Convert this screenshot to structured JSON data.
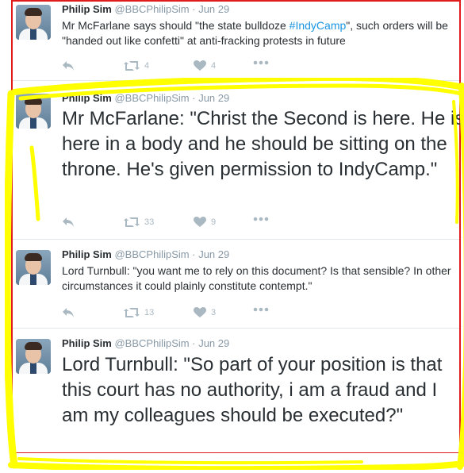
{
  "tweets": [
    {
      "name": "Philip Sim",
      "handle": "@BBCPhilipSim",
      "separator": "·",
      "time": "Jun 29",
      "text_before": "Mr McFarlane says should \"the state bulldoze ",
      "hashtag": "#IndyCamp",
      "text_after": "\", such orders will be \"handed out like confetti\" at anti-fracking protests in future",
      "retweets": "4",
      "likes": "4"
    },
    {
      "name": "Philip Sim",
      "handle": "@BBCPhilipSim",
      "separator": "·",
      "time": "Jun 29",
      "text": "Mr McFarlane: \"Christ the Second is here. He is here in a body and he should be sitting on the throne. He's given permission to IndyCamp.\"",
      "retweets": "33",
      "likes": "9"
    },
    {
      "name": "Philip Sim",
      "handle": "@BBCPhilipSim",
      "separator": "·",
      "time": "Jun 29",
      "text": "Lord Turnbull: \"you want me to rely on this document? Is that sensible? In other circumstances it could plainly constitute contempt.\"",
      "retweets": "13",
      "likes": "3"
    },
    {
      "name": "Philip Sim",
      "handle": "@BBCPhilipSim",
      "separator": "·",
      "time": "Jun 29",
      "text": "Lord Turnbull: \"So part of your position is that this court has no authority, i am a fraud and I am my colleagues should be executed?\""
    }
  ],
  "icons": {
    "reply": "reply-arrow-icon",
    "retweet": "retweet-icon",
    "like": "heart-icon",
    "more": "more-dots-icon"
  },
  "colors": {
    "frame": "#e01b1b",
    "highlight": "#ffff00",
    "hashtag": "#1b95e0",
    "icon": "#aab8c2"
  }
}
